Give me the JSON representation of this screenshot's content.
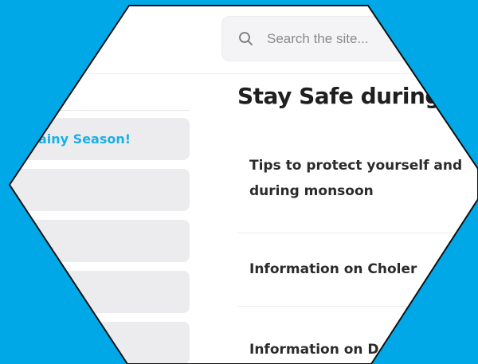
{
  "search": {
    "placeholder": "Search the site..."
  },
  "sidebar": {
    "items": [
      {
        "label": "ainy Season!"
      },
      {
        "label": ""
      },
      {
        "label": ""
      },
      {
        "label": ""
      },
      {
        "label": ""
      }
    ]
  },
  "main": {
    "title": "Stay Safe during",
    "articles": [
      {
        "line1": "Tips to protect yourself and",
        "line2": "during monsoon"
      },
      {
        "line1": "Information on Choler"
      },
      {
        "line1": "Information on D"
      }
    ]
  },
  "colors": {
    "background": "#00a8e8",
    "accent": "#19b0e8",
    "text": "#1f1f1f"
  }
}
